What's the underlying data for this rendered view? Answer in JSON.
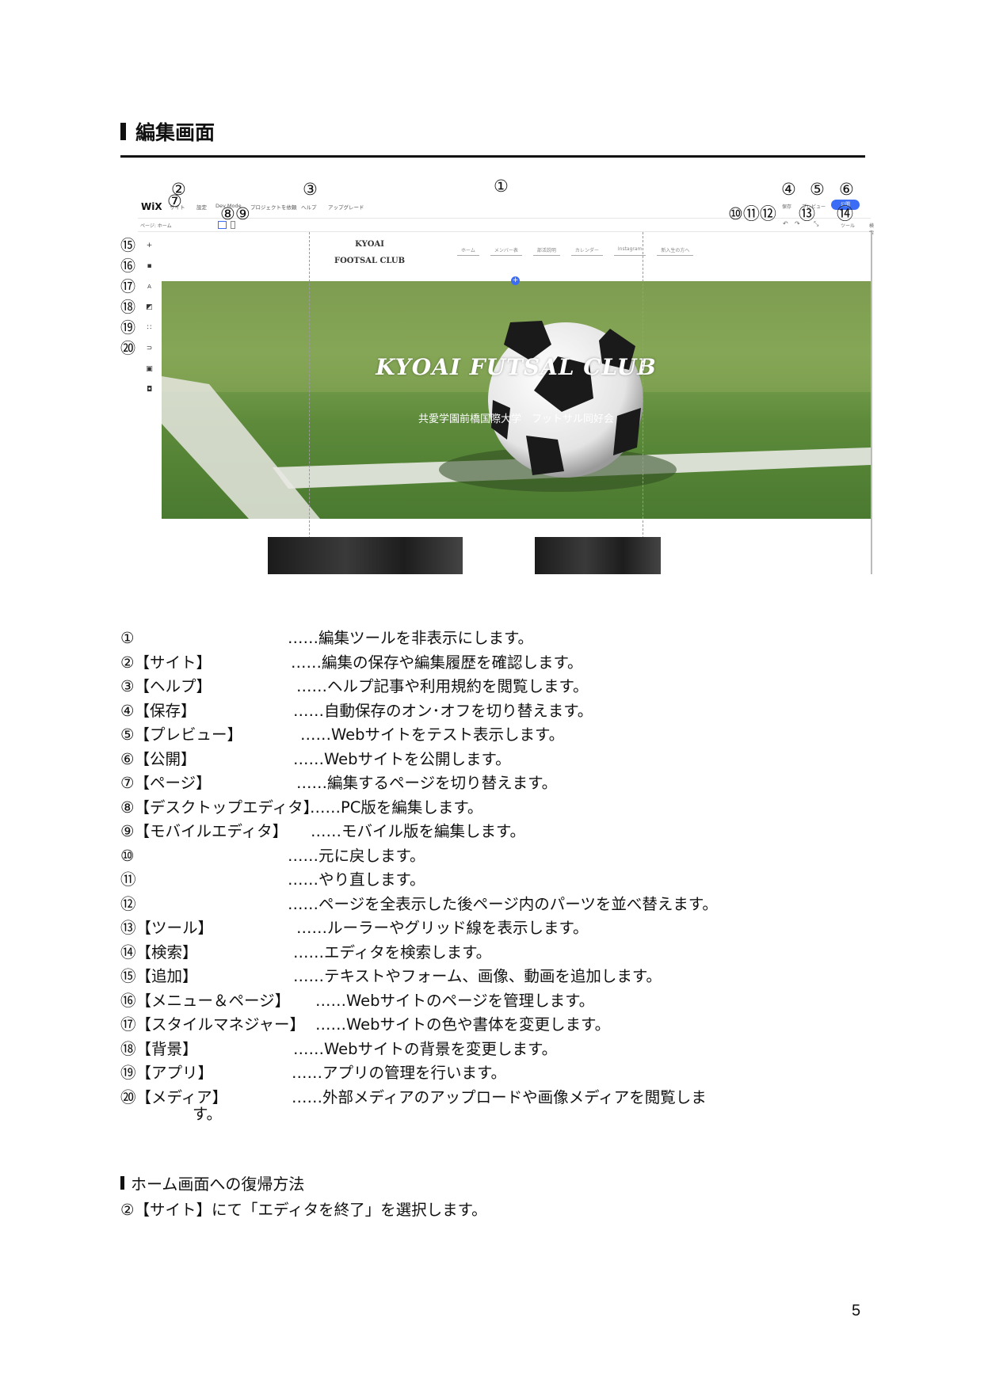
{
  "heading": "編集画面",
  "screenshot": {
    "logo": "WiX",
    "menu": [
      "サイト",
      "設定",
      "Dev Mode",
      "プロジェクトを依頼",
      "ヘルプ",
      "アップグレード"
    ],
    "save": "保存",
    "preview": "プレビュー",
    "publish": "公開",
    "page_select": "ページ: ホーム",
    "tools": "ツール",
    "search": "検索",
    "brand_line1": "KYOAI",
    "brand_line2": "FOOTSAL CLUB",
    "nav": [
      "ホーム",
      "メンバー表",
      "部活説明",
      "カレンダー",
      "Instagram",
      "新入生の方へ"
    ],
    "hero_title": "KYOAI FUTSAL CLUB",
    "hero_subtitle": "共愛学園前橋国際大学　フットサル同好会",
    "markers": [
      "①",
      "②",
      "③",
      "④",
      "⑤",
      "⑥",
      "⑦",
      "⑧⑨",
      "⑩⑪⑫",
      "⑬",
      "⑭",
      "⑮",
      "⑯",
      "⑰",
      "⑱",
      "⑲",
      "⑳"
    ]
  },
  "items": [
    {
      "label": "①",
      "desc": "……編集ツールを非表示にします。"
    },
    {
      "label": "②【サイト】",
      "desc": "……編集の保存や編集履歴を確認します。"
    },
    {
      "label": "③【ヘルプ】",
      "desc": "……ヘルプ記事や利用規約を閲覧します。"
    },
    {
      "label": "④【保存】",
      "desc": "……自動保存のオン･オフを切り替えます。"
    },
    {
      "label": "⑤【プレビュー】",
      "desc": "……Webサイトをテスト表示します。"
    },
    {
      "label": "⑥【公開】",
      "desc": "……Webサイトを公開します。"
    },
    {
      "label": "⑦【ページ】",
      "desc": "……編集するページを切り替えます。"
    },
    {
      "label": "⑧【デスクトップエディタ】",
      "desc": "……PC版を編集します。"
    },
    {
      "label": "⑨【モバイルエディタ】",
      "desc": "……モバイル版を編集します。"
    },
    {
      "label": "⑩",
      "desc": "……元に戻します。"
    },
    {
      "label": "⑪",
      "desc": "……やり直します。"
    },
    {
      "label": "⑫",
      "desc": "……ページを全表示した後ページ内のパーツを並べ替えます。"
    },
    {
      "label": "⑬【ツール】",
      "desc": "……ルーラーやグリッド線を表示します。"
    },
    {
      "label": "⑭【検索】",
      "desc": "……エディタを検索します。"
    },
    {
      "label": "⑮【追加】",
      "desc": "……テキストやフォーム、画像、動画を追加します。"
    },
    {
      "label": "⑯【メニュー＆ページ】",
      "desc": "……Webサイトのページを管理します。"
    },
    {
      "label": "⑰【スタイルマネジャー】",
      "desc": "……Webサイトの色や書体を変更します。"
    },
    {
      "label": "⑱【背景】",
      "desc": "……Webサイトの背景を変更します。"
    },
    {
      "label": "⑲【アプリ】",
      "desc": "……アプリの管理を行います。"
    },
    {
      "label": "⑳【メディア】",
      "desc": "……外部メディアのアップロードや画像メディアを閲覧しま"
    }
  ],
  "continuation": "す。",
  "section2_title": "ホーム画面への復帰方法",
  "section2_body": "②【サイト】にて「エディタを終了」を選択します。",
  "page_number": "5"
}
